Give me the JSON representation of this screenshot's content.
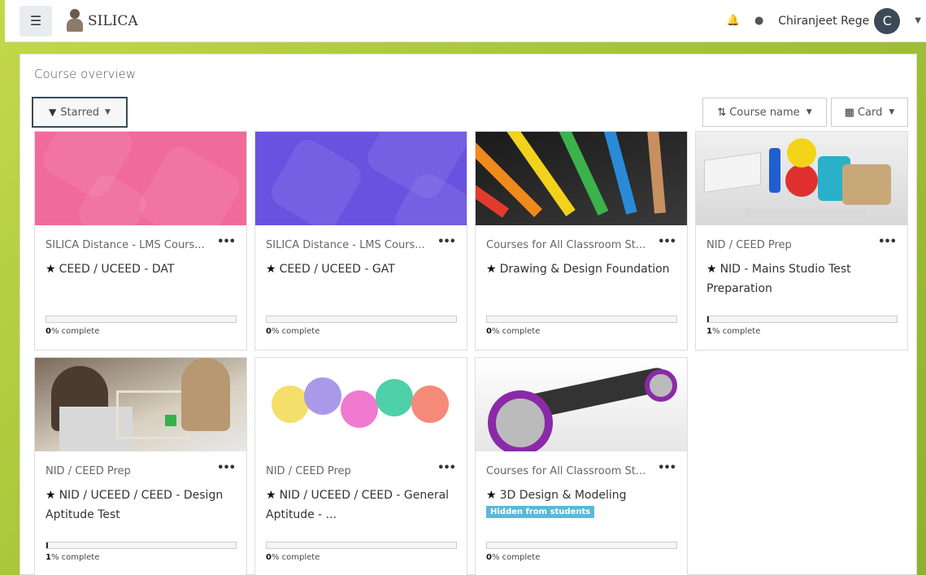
{
  "header": {
    "menu_icon": "hamburger-icon",
    "brand": "SILICA",
    "user_name": "Chiranjeet Rege",
    "avatar_letter": "C"
  },
  "page": {
    "title": "Course overview",
    "filter_label": "Starred",
    "sort_label": "Course name",
    "view_label": "Card"
  },
  "courses": [
    {
      "category": "SILICA Distance - LMS Cours...",
      "title": "CEED / UCEED - DAT",
      "progress": 0,
      "progress_label": "0",
      "progress_suffix": "% complete",
      "image": "pink-pattern"
    },
    {
      "category": "SILICA Distance - LMS Cours...",
      "title": "CEED / UCEED - GAT",
      "progress": 0,
      "progress_label": "0",
      "progress_suffix": "% complete",
      "image": "purple-pattern"
    },
    {
      "category": "Courses for All Classroom St...",
      "title": "Drawing & Design Foundation",
      "progress": 0,
      "progress_label": "0",
      "progress_suffix": "% complete",
      "image": "colored-pencils"
    },
    {
      "category": "NID / CEED Prep",
      "title": "NID - Mains Studio Test Preparation",
      "progress": 1,
      "progress_label": "1",
      "progress_suffix": "% complete",
      "image": "craft-supplies"
    },
    {
      "category": "NID / CEED Prep",
      "title": "NID / UCEED / CEED - Design Aptitude Test",
      "progress": 1,
      "progress_label": "1",
      "progress_suffix": "% complete",
      "image": "workshop-students"
    },
    {
      "category": "NID / CEED Prep",
      "title": "NID / UCEED / CEED - General Aptitude - ...",
      "progress": 0,
      "progress_label": "0",
      "progress_suffix": "% complete",
      "image": "design-thinking"
    },
    {
      "category": "Courses for All Classroom St...",
      "title": "3D Design & Modeling",
      "badge": "Hidden from students",
      "progress": 0,
      "progress_label": "0",
      "progress_suffix": "% complete",
      "image": "3d-car-model"
    }
  ],
  "colors": {
    "accent": "#3a4a58",
    "badge": "#5bb8d8",
    "background": "#a9c63a"
  }
}
